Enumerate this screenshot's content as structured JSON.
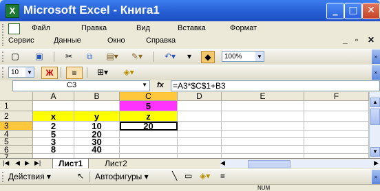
{
  "window": {
    "title": "Microsoft Excel - Книга1",
    "app_icon": "X"
  },
  "menu": {
    "row1": [
      "Файл",
      "Правка",
      "Вид",
      "Вставка",
      "Формат"
    ],
    "row2": [
      "Сервис",
      "Данные",
      "Окно",
      "Справка"
    ]
  },
  "toolbar": {
    "zoom": "100%",
    "font_size": "10"
  },
  "formula_bar": {
    "cell_ref": "C3",
    "fx": "fx",
    "formula": "=A3*$C$1+B3"
  },
  "sheet": {
    "columns": [
      "A",
      "B",
      "C",
      "D",
      "E",
      "F"
    ],
    "rows": [
      "1",
      "2",
      "3",
      "4",
      "5",
      "6",
      "7"
    ],
    "cells": {
      "C1": "5",
      "A2": "x",
      "B2": "y",
      "C2": "z",
      "A3": "2",
      "B3": "10",
      "C3": "20",
      "A4": "5",
      "B4": "20",
      "A5": "3",
      "B5": "30",
      "A6": "8",
      "B6": "40"
    }
  },
  "tabs": {
    "items": [
      "Лист1",
      "Лист2"
    ],
    "active": "Лист1"
  },
  "drawing": {
    "actions": "Действия",
    "autoshapes": "Автофигуры"
  },
  "status": {
    "num": "NUM"
  },
  "colors": {
    "header_yellow": "#ffff00",
    "magenta": "#ff33ff",
    "titlebar": "#2a63d8"
  }
}
